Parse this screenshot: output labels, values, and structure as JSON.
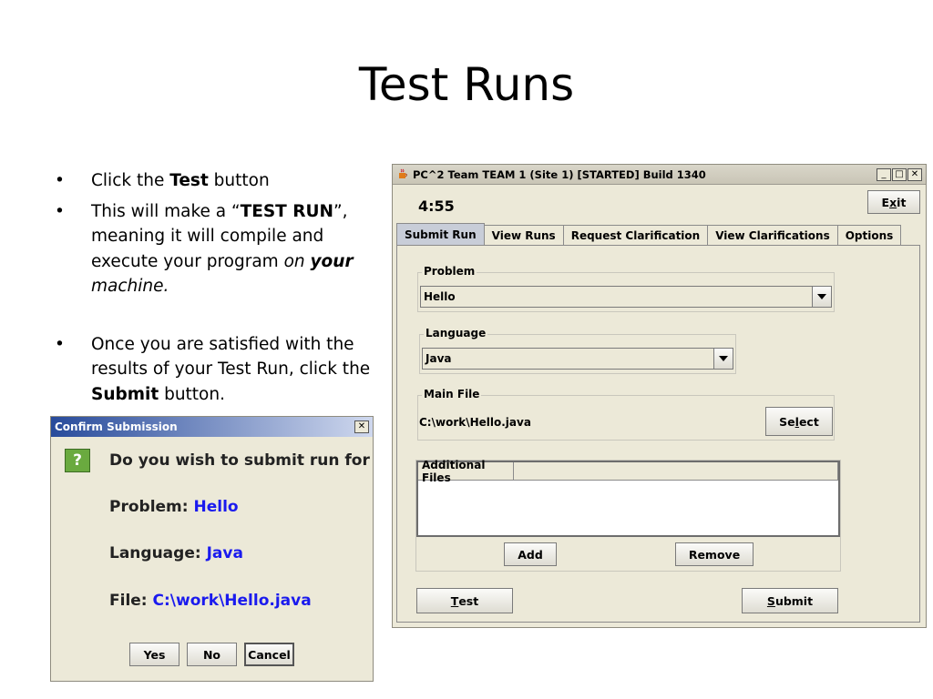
{
  "slide": {
    "title": "Test Runs",
    "bullets": [
      {
        "pre": "Click the ",
        "bold1": "Test",
        "post": " button"
      },
      {
        "pre": "This will make a “",
        "bold1": "TEST RUN",
        "mid": "”, meaning it will compile and execute your program ",
        "italic": "on ",
        "bolditalic": "your",
        "post": " machine."
      },
      {
        "pre": "Once you are satisfied with the results of your Test Run, click the ",
        "bold1": "Submit",
        "post": " button."
      }
    ]
  },
  "main_window": {
    "title": "PC^2 Team TEAM 1 (Site 1) [STARTED] Build 1340",
    "clock": "4:55",
    "exit_label": {
      "pre": "E",
      "mn": "x",
      "post": "it"
    },
    "tabs": [
      "Submit Run",
      "View Runs",
      "Request Clarification",
      "View Clarifications",
      "Options"
    ],
    "problem": {
      "label": "Problem",
      "value": "Hello"
    },
    "language": {
      "label": "Language",
      "value": "Java"
    },
    "main_file": {
      "label": "Main File",
      "path": "C:\\work\\Hello.java",
      "select_label": {
        "pre": "Se",
        "mn": "l",
        "post": "ect"
      }
    },
    "additional_files": {
      "header": "Additional Files",
      "add_label": "Add",
      "remove_label": "Remove"
    },
    "test_label": {
      "mn": "T",
      "post": "est"
    },
    "submit_label": {
      "mn": "S",
      "post": "ubmit"
    }
  },
  "dialog": {
    "title": "Confirm Submission",
    "question": "Do you wish to submit run for",
    "problem_label": "Problem: ",
    "problem_value": "Hello",
    "language_label": "Language: ",
    "language_value": "Java",
    "file_label": "File: ",
    "file_value": "C:\\work\\Hello.java",
    "yes_label": "Yes",
    "no_label": "No",
    "cancel_label": "Cancel"
  }
}
